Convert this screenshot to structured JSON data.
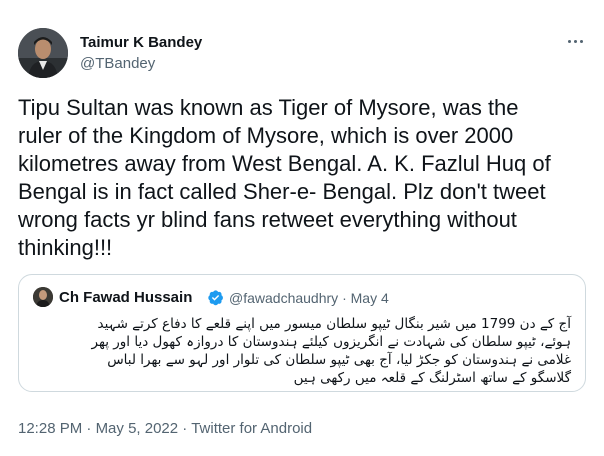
{
  "author": {
    "name": "Taimur K Bandey",
    "handle": "@TBandey"
  },
  "tweet": {
    "text": "Tipu Sultan was known as Tiger of Mysore, was the\nruler of the Kingdom of Mysore, which is over 2000\nkilometres away from West Bengal. A. K. Fazlul Huq of\nBengal is in fact called Sher-e- Bengal. Plz don't tweet\nwrong facts yr blind fans retweet everything without\nthinking!!!"
  },
  "quoted_tweet": {
    "author_name": "Ch Fawad Hussain",
    "handle": "@fawadchaudhry",
    "separator": "·",
    "date": "May 4",
    "text": "آج کے دن 1799 میں شیر بنگال ٹیپو سلطان میسور میں اپنے قلعے کا دفاع کرتے شہید\nہوئے،  ٹیپو سلطان کی شہادت نے انگریزوں کیلئے ہندوستان کا دروازہ کھول دیا اور پھر\nغلامی نے ہندوستان کو جکڑ لیا، آج بھی ٹیپو سلطان کی تلوار اور لہو سے بھرا لباس\nگلاسگو کے ساتھ اسٹرلنگ کے قلعہ میں رکھی ہیں",
    "verified_badge_color": "#1d9bf0"
  },
  "footer": {
    "time": "12:28 PM",
    "separator_1": "·",
    "date": "May 5, 2022",
    "separator_2": "·",
    "source": "Twitter for Android"
  },
  "icons": {
    "more": "more-horizontal-icon",
    "verified": "verified-badge-icon"
  }
}
